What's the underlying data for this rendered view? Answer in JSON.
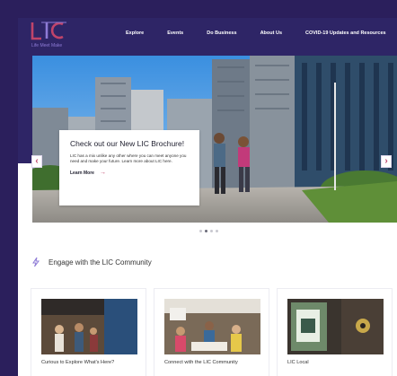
{
  "brand": {
    "tagline": "Life Meet Make"
  },
  "nav": {
    "items": [
      "Explore",
      "Events",
      "Do Business",
      "About Us",
      "COVID-19 Updates and Resources"
    ]
  },
  "hero": {
    "promo_title": "Check out our New LIC Brochure!",
    "promo_body": "LIC has a mix unlike any other where you can meet anyone you need and make your future. Learn more about LIC here.",
    "promo_link": "Learn More",
    "slide_count": 4,
    "active_slide": 2
  },
  "engage": {
    "title": "Engage with the LIC Community"
  },
  "cards": [
    {
      "title": "Curious to Explore What's Here?"
    },
    {
      "title": "Connect with the LIC Community"
    },
    {
      "title": "LIC Local"
    }
  ],
  "colors": {
    "nav_bg": "#2e2566",
    "page_bg": "#2b1f5c",
    "accent": "#c0446a"
  }
}
